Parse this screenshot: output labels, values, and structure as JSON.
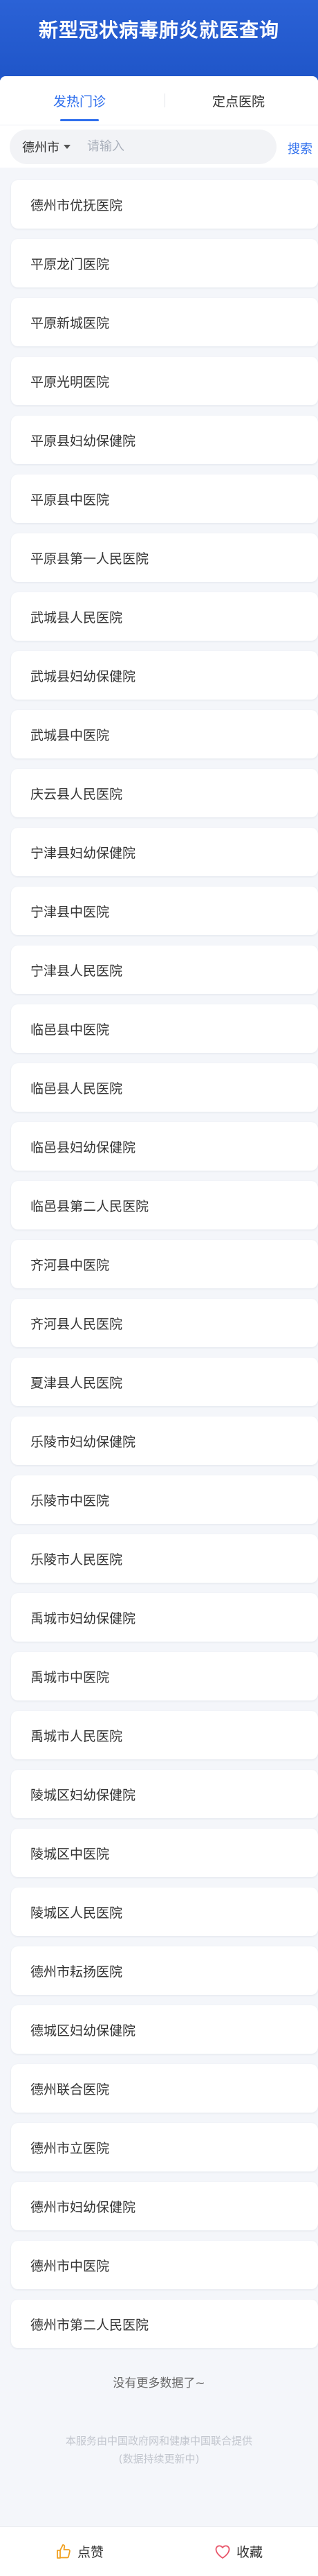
{
  "header": {
    "title": "新型冠状病毒肺炎就医查询"
  },
  "tabs": [
    {
      "label": "发热门诊",
      "active": true
    },
    {
      "label": "定点医院",
      "active": false
    }
  ],
  "search": {
    "city": "德州市",
    "placeholder": "请输入",
    "button_label": "搜索"
  },
  "hospitals": [
    "德州市优抚医院",
    "平原龙门医院",
    "平原新城医院",
    "平原光明医院",
    "平原县妇幼保健院",
    "平原县中医院",
    "平原县第一人民医院",
    "武城县人民医院",
    "武城县妇幼保健院",
    "武城县中医院",
    "庆云县人民医院",
    "宁津县妇幼保健院",
    "宁津县中医院",
    "宁津县人民医院",
    "临邑县中医院",
    "临邑县人民医院",
    "临邑县妇幼保健院",
    "临邑县第二人民医院",
    "齐河县中医院",
    "齐河县人民医院",
    "夏津县人民医院",
    "乐陵市妇幼保健院",
    "乐陵市中医院",
    "乐陵市人民医院",
    "禹城市妇幼保健院",
    "禹城市中医院",
    "禹城市人民医院",
    "陵城区妇幼保健院",
    "陵城区中医院",
    "陵城区人民医院",
    "德州市耘扬医院",
    "德城区妇幼保健院",
    "德州联合医院",
    "德州市立医院",
    "德州市妇幼保健院",
    "德州市中医院",
    "德州市第二人民医院"
  ],
  "footer": {
    "no_more": "没有更多数据了~",
    "source_line1": "本服务由中国政府网和健康中国联合提供",
    "source_line2": "(数据持续更新中)"
  },
  "actions": {
    "like_label": "点赞",
    "favorite_label": "收藏"
  },
  "colors": {
    "header": "#1f55c8",
    "accent": "#2f6fed",
    "background": "#f4f6fa"
  }
}
